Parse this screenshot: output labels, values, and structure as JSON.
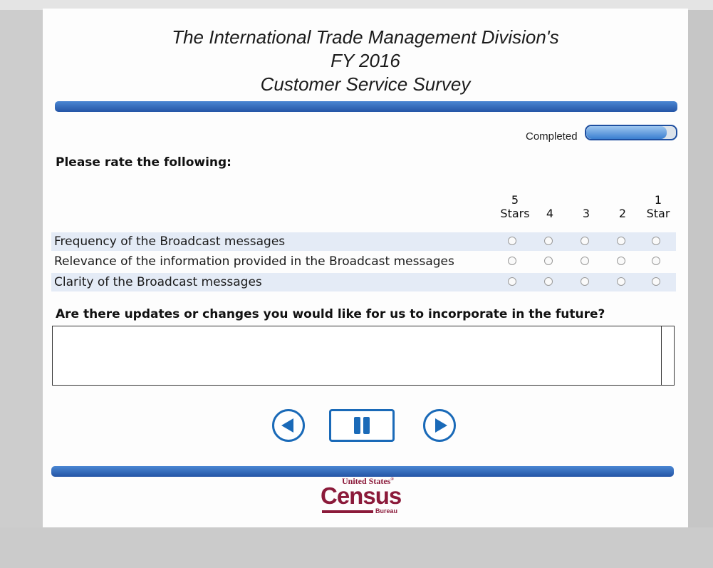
{
  "survey": {
    "title_line1": "The International Trade Management Division's",
    "title_line2": "FY 2016",
    "title_line3": "Customer Service Survey"
  },
  "progress": {
    "label": "Completed",
    "fraction": 0.9
  },
  "rating": {
    "heading": "Please rate the following:",
    "scale": [
      {
        "top": "5",
        "bottom": "Stars"
      },
      {
        "top": "",
        "bottom": "4"
      },
      {
        "top": "",
        "bottom": "3"
      },
      {
        "top": "",
        "bottom": "2"
      },
      {
        "top": "1",
        "bottom": "Star"
      }
    ],
    "questions": [
      {
        "label": "Frequency of the Broadcast messages"
      },
      {
        "label": "Relevance of the information provided in the Broadcast messages"
      },
      {
        "label": "Clarity of the Broadcast messages"
      }
    ]
  },
  "comments": {
    "question": "Are there updates or changes you would like for us to incorporate in the future?",
    "value": ""
  },
  "navigation": {
    "prev_icon": "previous-arrow",
    "pause_icon": "pause",
    "next_icon": "next-arrow"
  },
  "logo": {
    "top": "United States",
    "tm": "®",
    "main": "Census",
    "bottom": "Bureau"
  },
  "colors": {
    "accent_blue": "#2a5fb0",
    "census_maroon": "#8b1a3a"
  }
}
